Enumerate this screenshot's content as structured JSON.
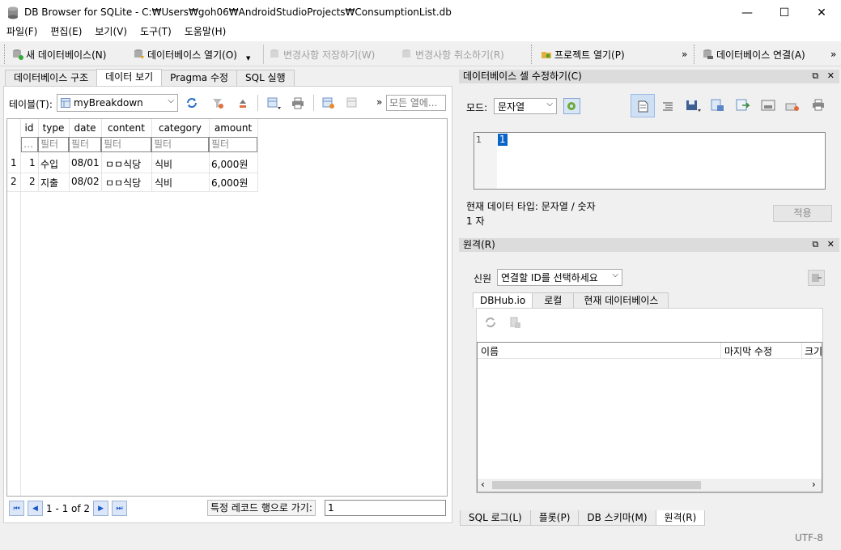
{
  "window": {
    "title": "DB Browser for SQLite - C:₩Users₩goh06₩AndroidStudioProjects₩ConsumptionList.db",
    "minimize": "—",
    "maximize": "☐",
    "close": "✕"
  },
  "menu": [
    "파일(F)",
    "편집(E)",
    "보기(V)",
    "도구(T)",
    "도움말(H)"
  ],
  "toolbar": {
    "new_db": "새 데이터베이스(N)",
    "open_db": "데이터베이스 열기(O)",
    "write_changes": "변경사항 저장하기(W)",
    "revert_changes": "변경사항 취소하기(R)",
    "open_project": "프로젝트 열기(P)",
    "attach_db": "데이터베이스 연결(A)",
    "overflow": "»"
  },
  "left_tabs": [
    "데이터베이스 구조",
    "데이터 보기",
    "Pragma 수정",
    "SQL 실행"
  ],
  "browse": {
    "table_label": "테이블(T):",
    "table_selected": "myBreakdown",
    "filter_all_placeholder": "모든 열에...",
    "columns": [
      "id",
      "type",
      "date",
      "content",
      "category",
      "amount"
    ],
    "filter_placeholder": "필터",
    "filter_first": "…",
    "rows": [
      {
        "rownum": "1",
        "id": "1",
        "type": "수입",
        "date": "08/01",
        "content": "ㅁㅁ식당",
        "category": "식비",
        "amount": "6,000원"
      },
      {
        "rownum": "2",
        "id": "2",
        "type": "지출",
        "date": "08/02",
        "content": "ㅁㅁ식당",
        "category": "식비",
        "amount": "6,000원"
      }
    ],
    "record_range": "1 - 1 of 2",
    "goto_label": "특정 레코드 행으로 가기:",
    "goto_value": "1"
  },
  "edit_cell": {
    "header": "데이터베이스 셀 수정하기(C)",
    "mode_label": "모드:",
    "mode_value": "문자열",
    "line_number": "1",
    "cell_value": "1",
    "data_type": "현재 데이터 타입: 문자열 / 숫자",
    "size": "1 자",
    "apply": "적용"
  },
  "remote": {
    "header": "원격(R)",
    "identity_label": "신원",
    "identity_value": "연결할 ID를 선택하세요",
    "tabs": [
      "DBHub.io",
      "로컬",
      "현재 데이터베이스"
    ],
    "columns": [
      "이름",
      "마지막 수정",
      "크기"
    ]
  },
  "bottom_tabs": [
    "SQL 로그(L)",
    "플롯(P)",
    "DB 스키마(M)",
    "원격(R)"
  ],
  "status": {
    "encoding": "UTF-8"
  },
  "colors": {
    "accent": "#1a56c8",
    "selection": "#0a64c8"
  }
}
